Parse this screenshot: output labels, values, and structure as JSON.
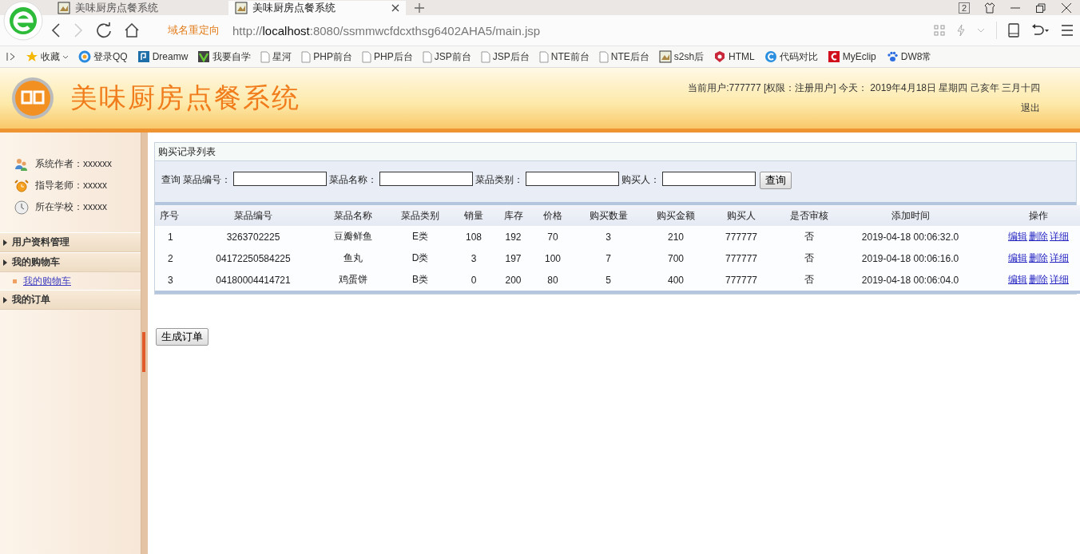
{
  "browser": {
    "tabs": [
      {
        "title": "美味厨房点餐系统",
        "selected": false
      },
      {
        "title": "美味厨房点餐系统",
        "selected": true
      }
    ],
    "tab_count": "2",
    "redirect_label": "域名重定向",
    "url": {
      "scheme": "http://",
      "host": "localhost",
      "path": ":8080/ssmmwcfdcxthsg6402AHA5/main.jsp"
    },
    "bookmarks": [
      {
        "label": "收藏",
        "kind": "star"
      },
      {
        "label": "登录QQ",
        "kind": "qq"
      },
      {
        "label": "Dreamw",
        "kind": "dw"
      },
      {
        "label": "我要自学",
        "kind": "v"
      },
      {
        "label": "星河",
        "kind": "page"
      },
      {
        "label": "PHP前台",
        "kind": "page"
      },
      {
        "label": "PHP后台",
        "kind": "page"
      },
      {
        "label": "JSP前台",
        "kind": "page"
      },
      {
        "label": "JSP后台",
        "kind": "page"
      },
      {
        "label": "NTE前台",
        "kind": "page"
      },
      {
        "label": "NTE后台",
        "kind": "page"
      },
      {
        "label": "s2sh后",
        "kind": "picture"
      },
      {
        "label": "HTML",
        "kind": "html"
      },
      {
        "label": "代码对比",
        "kind": "c"
      },
      {
        "label": "MyEclip",
        "kind": "me"
      },
      {
        "label": "DW8常",
        "kind": "paw"
      }
    ]
  },
  "header": {
    "title": "美味厨房点餐系统",
    "user_info": "当前用户:777777 [权限：注册用户] 今天： 2019年4月18日 星期四 己亥年 三月十四",
    "logout": "退出"
  },
  "sidebar": {
    "info": [
      {
        "kind": "author",
        "text": "系统作者：xxxxxx"
      },
      {
        "kind": "teacher",
        "text": "指导老师：xxxxx"
      },
      {
        "kind": "school",
        "text": "所在学校：xxxxx"
      }
    ],
    "menu": [
      {
        "label": "用户资料管理"
      },
      {
        "label": "我的购物车",
        "children": [
          {
            "label": "我的购物车"
          }
        ]
      },
      {
        "label": "我的订单"
      }
    ]
  },
  "main": {
    "panel_title": "购买记录列表",
    "search": {
      "prefix": "查询",
      "fields": [
        {
          "label": "菜品编号："
        },
        {
          "label": "菜品名称："
        },
        {
          "label": "菜品类别："
        },
        {
          "label": "购买人："
        }
      ],
      "button": "查询"
    },
    "table": {
      "columns": [
        "序号",
        "菜品编号",
        "菜品名称",
        "菜品类别",
        "销量",
        "库存",
        "价格",
        "购买数量",
        "购买金额",
        "购买人",
        "是否审核",
        "添加时间",
        "操作"
      ],
      "rows": [
        {
          "cells": [
            "1",
            "3263702225",
            "豆瓣鲜鱼",
            "E类",
            "108",
            "192",
            "70",
            "3",
            "210",
            "777777",
            "否",
            "2019-04-18 00:06:32.0"
          ],
          "actions": [
            "编辑",
            "删除",
            "详细"
          ]
        },
        {
          "cells": [
            "2",
            "04172250584225",
            "鱼丸",
            "D类",
            "3",
            "197",
            "100",
            "7",
            "700",
            "777777",
            "否",
            "2019-04-18 00:06:16.0"
          ],
          "actions": [
            "编辑",
            "删除",
            "详细"
          ]
        },
        {
          "cells": [
            "3",
            "04180004414721",
            "鸡蛋饼",
            "B类",
            "0",
            "200",
            "80",
            "5",
            "400",
            "777777",
            "否",
            "2019-04-18 00:06:04.0"
          ],
          "actions": [
            "编辑",
            "删除",
            "详细"
          ]
        }
      ]
    },
    "generate_button": "生成订单"
  }
}
